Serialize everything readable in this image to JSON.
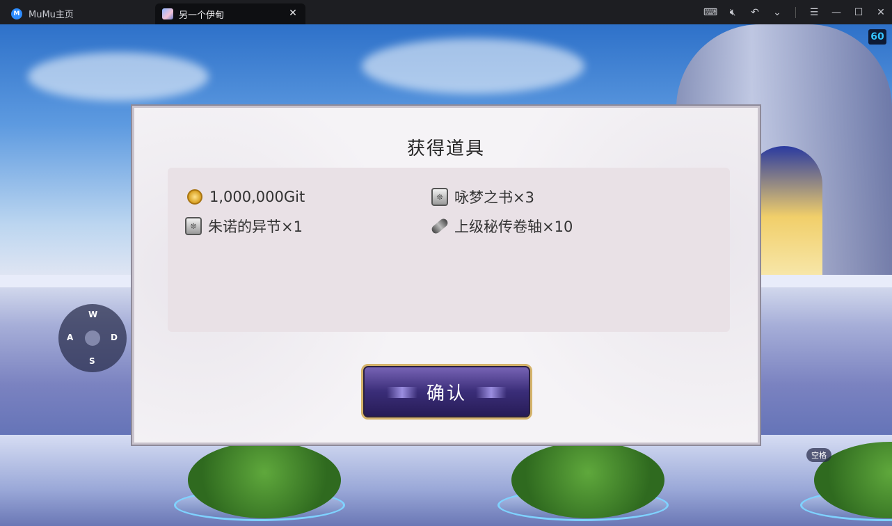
{
  "titlebar": {
    "home_tab": "MuMu主页",
    "game_tab": "另一个伊甸",
    "icons": [
      "keyboard-icon",
      "mute-icon",
      "undo-icon",
      "chevron-down-icon",
      "menu-icon",
      "minimize-icon",
      "maximize-icon",
      "close-icon"
    ]
  },
  "game": {
    "fps": "60",
    "dpad": {
      "up": "W",
      "left": "A",
      "right": "D",
      "down": "S"
    },
    "space_key": "空格"
  },
  "dialog": {
    "title": "获得道具",
    "items": [
      {
        "icon": "coin-icon",
        "label": "1,000,000Git"
      },
      {
        "icon": "book-icon",
        "label": "咏梦之书×3"
      },
      {
        "icon": "book-icon",
        "label": "朱诺的异节×1"
      },
      {
        "icon": "scroll-icon",
        "label": "上级秘传卷轴×10"
      }
    ],
    "confirm_label": "确认"
  }
}
